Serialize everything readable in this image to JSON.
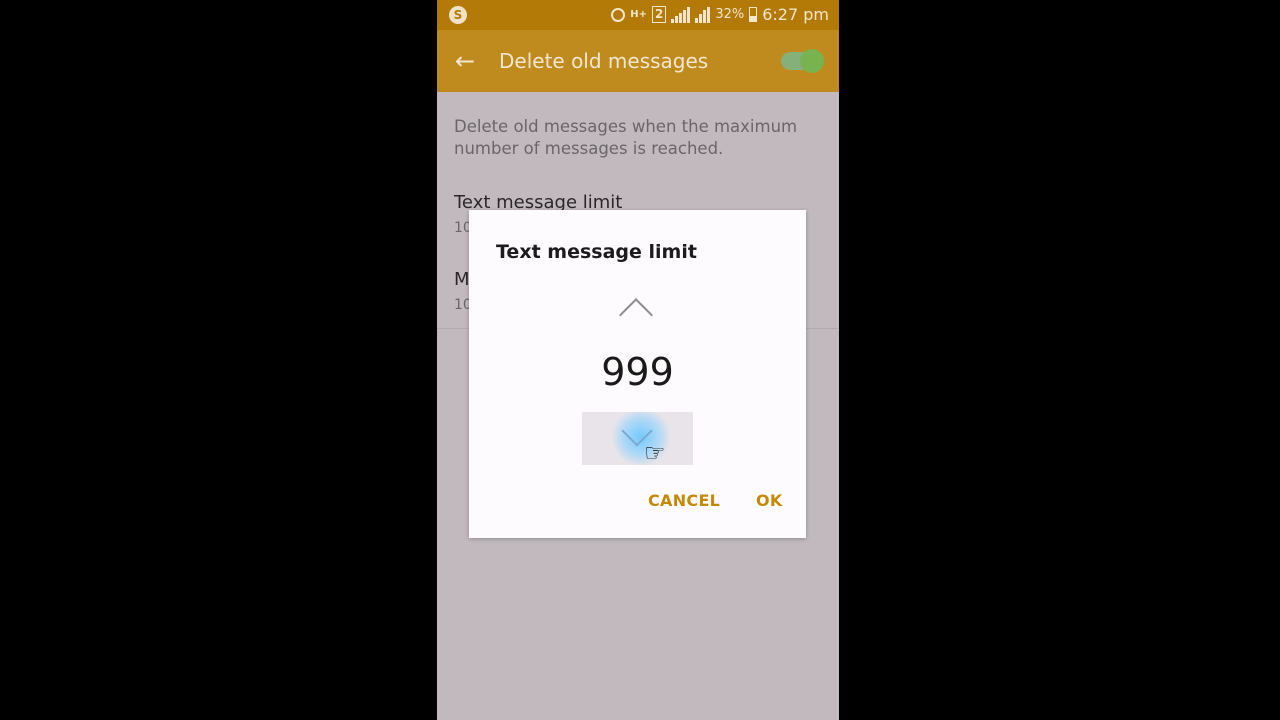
{
  "status_bar": {
    "network_type": "H+",
    "sim_slot": "2",
    "battery_percent": "32%",
    "time": "6:27 pm"
  },
  "app_bar": {
    "title": "Delete old messages",
    "toggle_on": true
  },
  "settings": {
    "description": "Delete old messages when the maximum number of messages is reached.",
    "items": [
      {
        "title": "Text message limit",
        "subtitle": "10"
      },
      {
        "title": "M",
        "subtitle": "10"
      }
    ]
  },
  "dialog": {
    "title": "Text message limit",
    "value": "999",
    "cancel_label": "CANCEL",
    "ok_label": "OK"
  },
  "colors": {
    "status_bar": "#b37a08",
    "app_bar": "#bf8a1e",
    "accent_button": "#c58a05",
    "toggle_green": "#79b34f",
    "ripple_blue": "#6ec8ff"
  },
  "icons": {
    "app": "app-notification-icon",
    "back": "back-arrow-icon",
    "up": "chevron-up-icon",
    "down": "chevron-down-icon",
    "cursor": "hand-pointer-icon"
  }
}
